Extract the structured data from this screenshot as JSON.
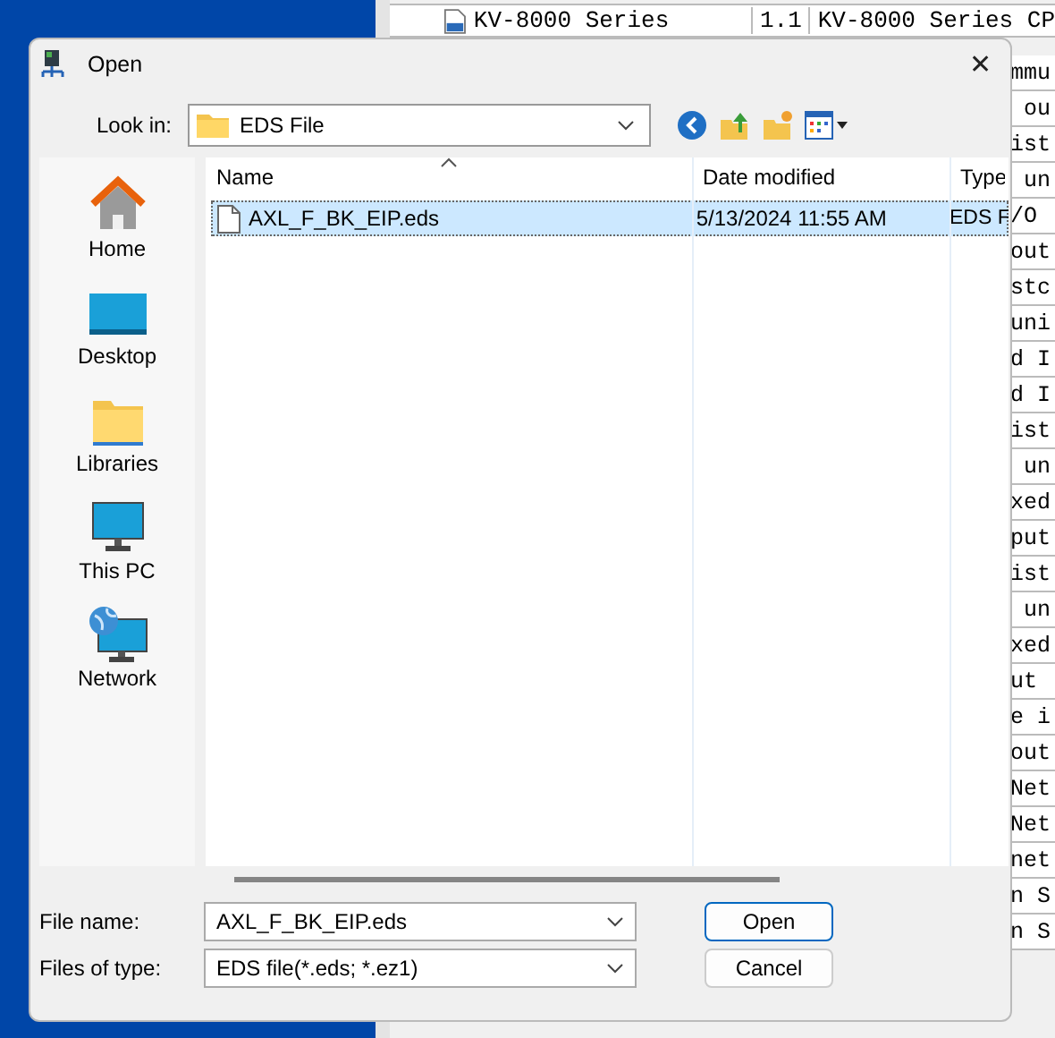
{
  "background_window": {
    "top_row": {
      "name": "KV-8000 Series",
      "version": "1.1",
      "description": "KV-8000 Series CP"
    },
    "fragments": [
      "mmu",
      " ou",
      "ist",
      " un",
      "/O",
      "out",
      "stc",
      "uni",
      "d I",
      "d I",
      "ist",
      " un",
      "xed",
      "put",
      "ist",
      " un",
      "xed",
      "ut ",
      "e i",
      "out",
      "Net",
      "Net",
      "net",
      "n S",
      "n S"
    ]
  },
  "dialog": {
    "title": "Open",
    "close": "✕",
    "look_in": {
      "label": "Look in:",
      "value": "EDS File"
    },
    "places": [
      {
        "kind": "home",
        "label": "Home"
      },
      {
        "kind": "desktop",
        "label": "Desktop"
      },
      {
        "kind": "libraries",
        "label": "Libraries"
      },
      {
        "kind": "pc",
        "label": "This PC"
      },
      {
        "kind": "network",
        "label": "Network"
      }
    ],
    "columns": [
      "Name",
      "Date modified",
      "Type"
    ],
    "files": [
      {
        "name": "AXL_F_BK_EIP.eds",
        "date": "5/13/2024 11:55 AM",
        "type": "EDS F",
        "selected": true
      }
    ],
    "file_name": {
      "label": "File name:",
      "value": "AXL_F_BK_EIP.eds"
    },
    "file_type": {
      "label": "Files of type:",
      "value": "EDS file(*.eds; *.ez1)"
    },
    "buttons": [
      "Open",
      "Cancel"
    ]
  }
}
